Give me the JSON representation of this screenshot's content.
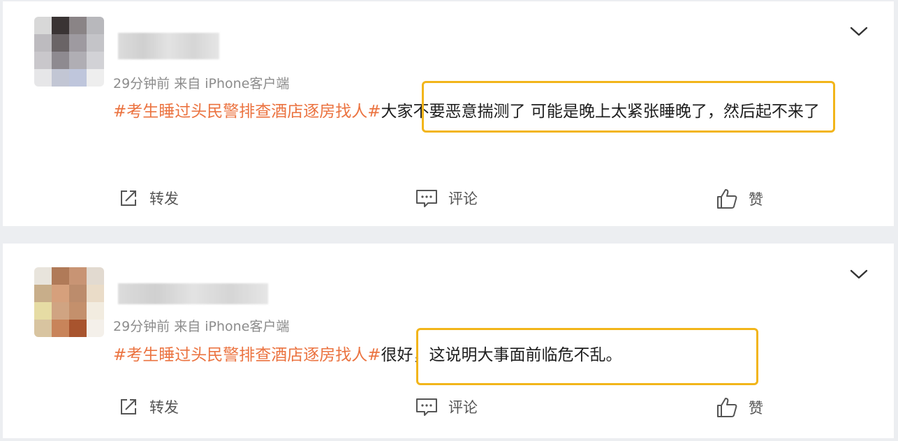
{
  "posts": [
    {
      "meta": "29分钟前  来自 iPhone客户端",
      "topic": "#考生睡过头民警排查酒店逐房找人#",
      "text": "大家不要恶意揣测了 可能是晚上太紧张睡晚了，然后起不来了",
      "actions": {
        "repost": "转发",
        "comment": "评论",
        "like": "赞"
      },
      "icons": {
        "menu": "chevron-down-icon",
        "repost": "share-icon",
        "comment": "comment-icon",
        "like": "thumbs-up-icon"
      }
    },
    {
      "meta": "29分钟前  来自 iPhone客户端",
      "topic": "#考生睡过头民警排查酒店逐房找人#",
      "text": "很好，这说明大事面前临危不乱。",
      "actions": {
        "repost": "转发",
        "comment": "评论",
        "like": "赞"
      },
      "icons": {
        "menu": "chevron-down-icon",
        "repost": "share-icon",
        "comment": "comment-icon",
        "like": "thumbs-up-icon"
      }
    }
  ],
  "colors": {
    "topic": "#eb7340",
    "highlight": "#f2b51a",
    "meta": "#8c8c8c"
  }
}
